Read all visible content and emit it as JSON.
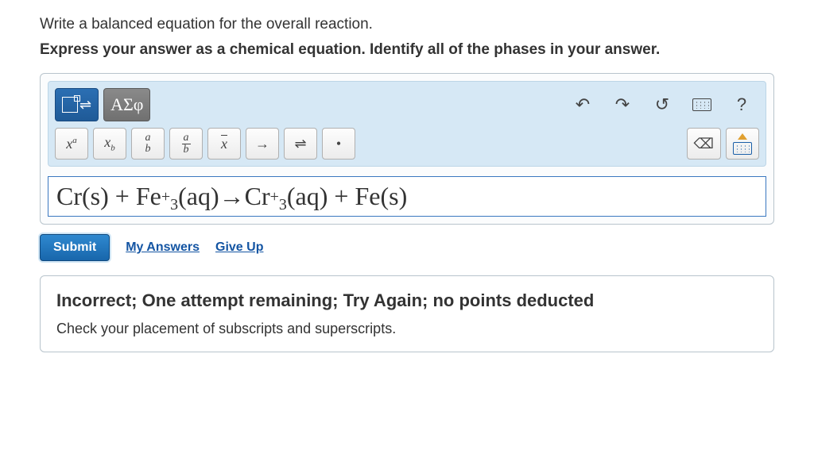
{
  "question": {
    "prompt": "Write a balanced equation for the overall reaction.",
    "emphasis": "Express your answer as a chemical equation. Identify all of the phases in your answer."
  },
  "toolbar": {
    "greek_label": "ΑΣφ",
    "undo": "↶",
    "redo": "↷",
    "reset": "↺",
    "help": "?",
    "superscript_label": "xᵃ",
    "subscript_label": "x_b",
    "xbar": "x̄",
    "arrow_right": "→",
    "reversible": "⇌",
    "dot": "•",
    "backspace": "⌫"
  },
  "answer": {
    "text_parts": {
      "p1": "Cr(s) + Fe",
      "sup1": "+",
      "sub1": "3",
      "p2": " (aq)→Cr",
      "sup2": "+",
      "sub2": "3",
      "p3": " (aq) + Fe(s)"
    }
  },
  "actions": {
    "submit": "Submit",
    "my_answers": "My Answers",
    "give_up": "Give Up"
  },
  "feedback": {
    "title": "Incorrect; One attempt remaining; Try Again; no points deducted",
    "hint": "Check your placement of subscripts and superscripts."
  }
}
